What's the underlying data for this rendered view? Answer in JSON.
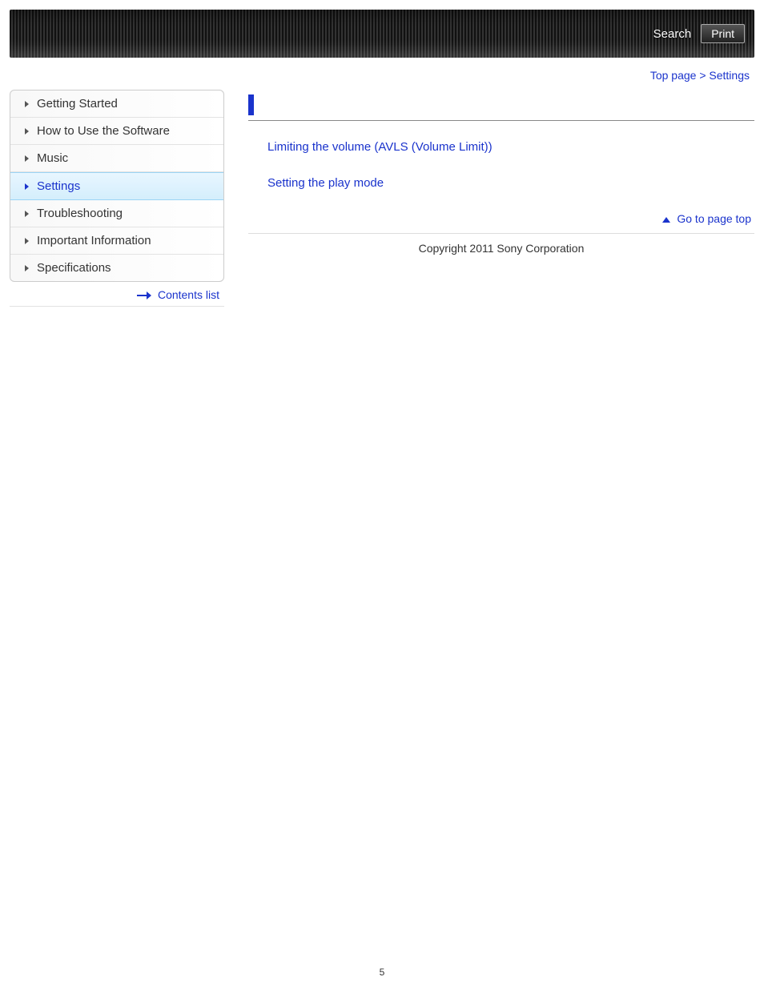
{
  "header": {
    "search_label": "Search",
    "print_label": "Print"
  },
  "breadcrumb": {
    "top_page": "Top page",
    "separator": " > ",
    "current": "Settings"
  },
  "sidebar": {
    "items": [
      {
        "label": "Getting Started",
        "active": false
      },
      {
        "label": "How to Use the Software",
        "active": false
      },
      {
        "label": "Music",
        "active": false
      },
      {
        "label": "Settings",
        "active": true
      },
      {
        "label": "Troubleshooting",
        "active": false
      },
      {
        "label": "Important Information",
        "active": false
      },
      {
        "label": "Specifications",
        "active": false
      }
    ],
    "contents_list_label": "Contents list"
  },
  "main": {
    "section_title": "",
    "links": [
      "Limiting the volume (AVLS (Volume Limit))",
      "Setting the play mode"
    ],
    "go_to_top_label": "Go to page top"
  },
  "footer": {
    "copyright": "Copyright 2011 Sony Corporation"
  },
  "page_number": "5"
}
